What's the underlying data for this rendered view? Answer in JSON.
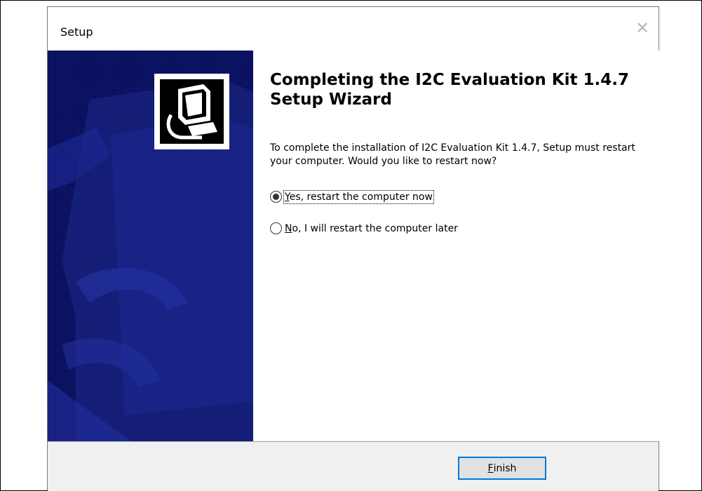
{
  "window": {
    "title": "Setup",
    "close_glyph": "✕"
  },
  "content": {
    "heading": "Completing the I2C Evaluation Kit 1.4.7 Setup Wizard",
    "description": "To complete the installation of I2C Evaluation Kit 1.4.7, Setup must restart your computer. Would you like to restart now?",
    "options": [
      {
        "mnemonic": "Y",
        "rest": "es, restart the computer now",
        "selected": true
      },
      {
        "mnemonic": "N",
        "rest": "o, I will restart the computer later",
        "selected": false
      }
    ]
  },
  "footer": {
    "finish_mnemonic": "F",
    "finish_rest": "inish"
  },
  "colors": {
    "banner": "#0a0f5c",
    "accent": "#0078d7"
  }
}
